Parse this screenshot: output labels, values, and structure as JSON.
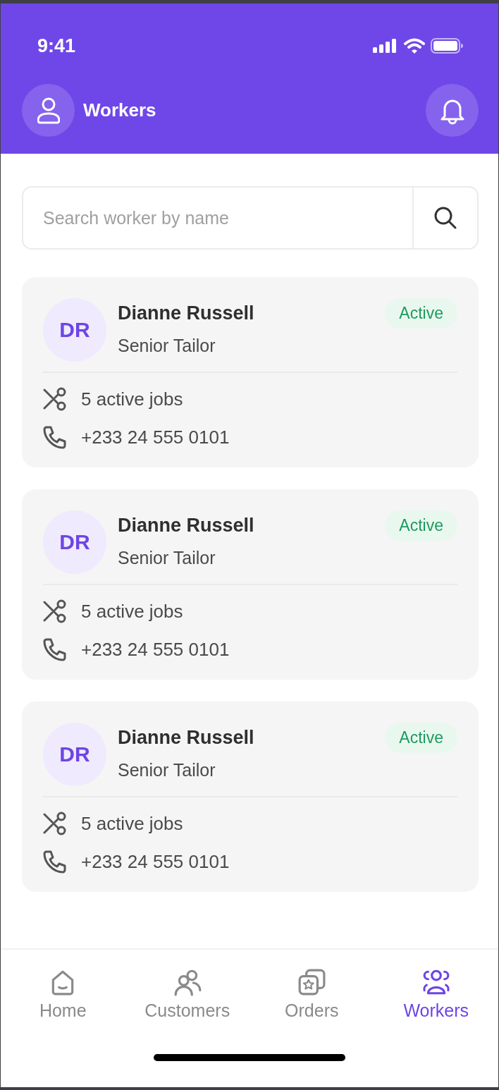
{
  "status_bar": {
    "time": "9:41"
  },
  "header": {
    "title": "Workers"
  },
  "search": {
    "placeholder": "Search worker by name"
  },
  "workers": [
    {
      "initials": "DR",
      "name": "Dianne Russell",
      "role": "Senior Tailor",
      "status": "Active",
      "jobs": "5 active jobs",
      "phone": "+233 24 555 0101"
    },
    {
      "initials": "DR",
      "name": "Dianne Russell",
      "role": "Senior Tailor",
      "status": "Active",
      "jobs": "5 active jobs",
      "phone": "+233 24 555 0101"
    },
    {
      "initials": "DR",
      "name": "Dianne Russell",
      "role": "Senior Tailor",
      "status": "Active",
      "jobs": "5 active jobs",
      "phone": "+233 24 555 0101"
    }
  ],
  "tabs": [
    {
      "kind": "home",
      "label": "Home",
      "selected": false
    },
    {
      "kind": "customers",
      "label": "Customers",
      "selected": false
    },
    {
      "kind": "orders",
      "label": "Orders",
      "selected": false
    },
    {
      "kind": "workers",
      "label": "Workers",
      "selected": true
    }
  ]
}
